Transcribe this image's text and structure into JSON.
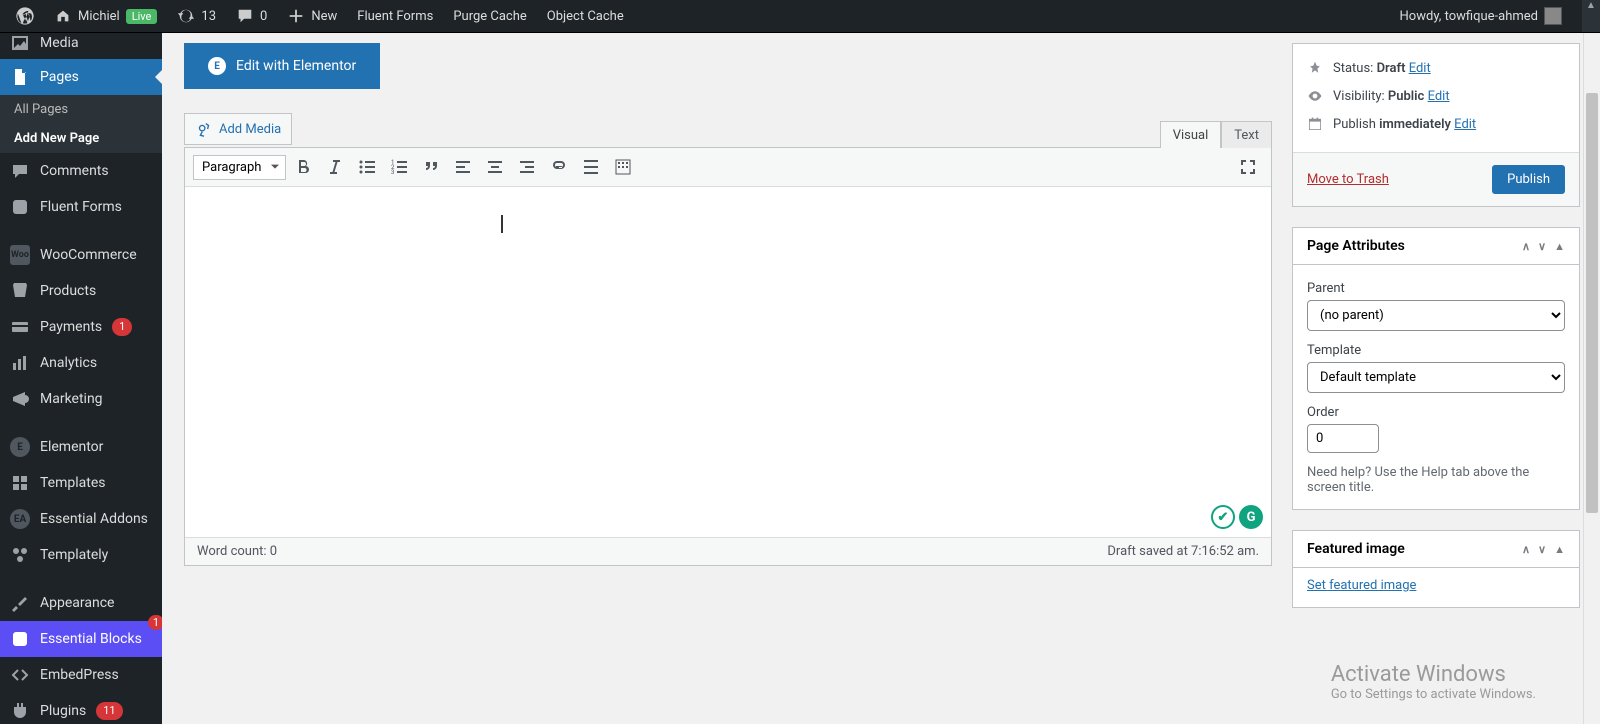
{
  "adminbar": {
    "site_name": "Michiel",
    "live_label": "Live",
    "updates_count": "13",
    "comments_count": "0",
    "new_label": "New",
    "links": [
      "Fluent Forms",
      "Purge Cache",
      "Object Cache"
    ],
    "howdy": "Howdy, towfique-ahmed"
  },
  "sidebar": {
    "media": "Media",
    "pages": "Pages",
    "sub_all": "All Pages",
    "sub_add": "Add New Page",
    "comments": "Comments",
    "fluent_forms": "Fluent Forms",
    "woo": "WooCommerce",
    "products": "Products",
    "payments": "Payments",
    "payments_badge": "1",
    "analytics": "Analytics",
    "marketing": "Marketing",
    "elementor": "Elementor",
    "templates": "Templates",
    "essential_addons": "Essential Addons",
    "templately": "Templately",
    "appearance": "Appearance",
    "essential_blocks": "Essential Blocks",
    "eb_badge": "1",
    "embedpress": "EmbedPress",
    "plugins": "Plugins",
    "plugins_badge": "11"
  },
  "editor": {
    "elementor_btn": "Edit with Elementor",
    "add_media": "Add Media",
    "tab_visual": "Visual",
    "tab_text": "Text",
    "block_format": "Paragraph",
    "word_count": "Word count: 0",
    "draft_saved": "Draft saved at 7:16:52 am."
  },
  "publish_box": {
    "status_label": "Status:",
    "status_value": "Draft",
    "visibility_label": "Visibility:",
    "visibility_value": "Public",
    "publish_label": "Publish",
    "publish_value": "immediately",
    "edit": "Edit",
    "trash": "Move to Trash",
    "publish_btn": "Publish"
  },
  "page_attr": {
    "title": "Page Attributes",
    "parent_label": "Parent",
    "parent_value": "(no parent)",
    "template_label": "Template",
    "template_value": "Default template",
    "order_label": "Order",
    "order_value": "0",
    "help": "Need help? Use the Help tab above the screen title."
  },
  "featured": {
    "title": "Featured image",
    "link": "Set featured image"
  },
  "activate": {
    "t1": "Activate Windows",
    "t2": "Go to Settings to activate Windows."
  }
}
